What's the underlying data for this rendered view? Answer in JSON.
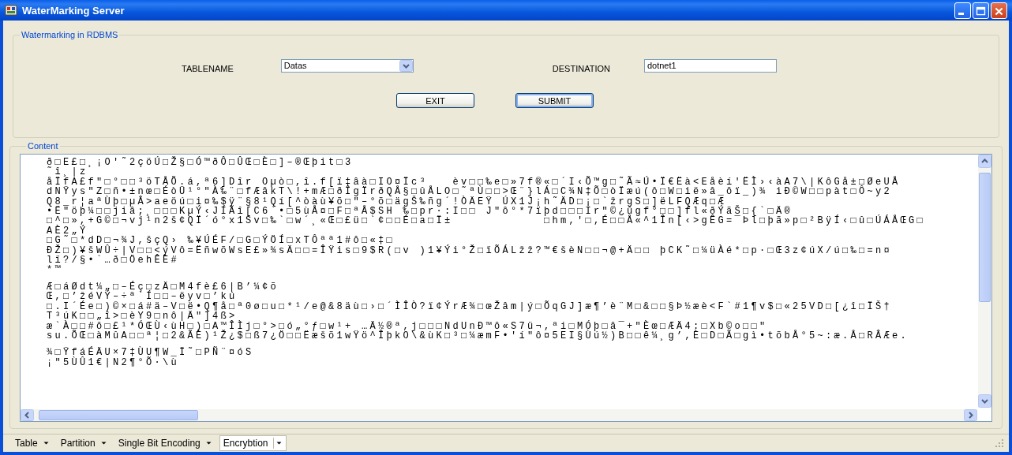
{
  "window": {
    "title": "WaterMarking Server"
  },
  "settings_group": {
    "title": "Watermarking in RDBMS",
    "tablename_label": "TABLENAME",
    "tablename_value": "Datas",
    "destination_label": "DESTINATION",
    "destination_value": "dotnet1",
    "buttons": [
      {
        "label": "EXIT",
        "focused": false
      },
      {
        "label": "SUBMIT",
        "focused": true
      }
    ]
  },
  "content_group": {
    "title": "Content",
    "paragraphs": [
      [
        "ð□E£□¸¡O′˜2çöÚ□Ž§□Ó™ðÔ□ÛŒ□È□]–®Œþit□3",
        "˜î¸|z",
        "åÏfA£f\"□°□□³öTÅÕ.á,ª6]Dîr Oµò□,î.f[ï‡âà□IO¤Ïc³   èv□□‰e□»7f®«□´I‹Õ™g□˜Ã≈Ú•Ï€Ëà<Eåèí'ËÌ›‹àA7\\|KôGå±□ØeUÅ",
        "dNŸys″Z□ñ•±nœ□ÉòÜ¹°″À‰¨□fÆâkT\\!+mÆ□ðÎgÏrðQÅ§□ûÅLO□˜ªÙ□□>Œ¨}lÁ□C¾N‡Õ□òÏæú(ô□W□ië»â_ôï_)¾ iÐ©W□□pàt□Ô~y2",
        "Q8_r¦aªÙþ□µÂ>aeöú□i¤‰$ÿ¨§8¹Qí[^òàù¥õ□″–°õ□ägŠ‰ñg´!ÒÄEŸ ÚX1J¡h˜ÄD□¡□`žrgS□]ëLFQÆq□Æ",
        "•Ë″öþ¼□□jiâ;¸□□□KµÝ‹JÍÃî[C6`•□5ùÅ¤□F□ªÅ$SH ‰□pr·:I□□ J″ô°*7ïþd□□□Ir″©¿ûgf°□□]fl«ðÝãŠ□{`□Ä®",
        "□^□»,+G©□¬vj¹n2š¢QÏ´ó°x1Sv□‰`□w´¸«Œ□£ü□`¢□□É□a□Ï±           □hm,'□,É□□Å«^1În[‹>gÊG=¯Þl□þã»p□²BÿÍ‹□û□ÚÁÅŒG□",
        "AÈ2„Ý",
        "□G˜□*dD□¬¾J,šçQ› ‰¥ÚÉF/□G□ÝÖÍ□xTÔªª1#ô□«‡□",
        "ÐŽ□)¥šWÛ÷|V□□<ýVô=ËñwõWsE£»¾sÄ□□=ÎŸis□9$R(□v )1¥Ýi°Ž□ïÕÁLžž?™€šèN□□¬@+Ä□□ þCK˜□¼üÀé*□p·□Œ3z¢úX/ú□‰□=n¤",
        "lï?/§•`…ð□ÖehÊÈ#",
        "*™"
      ],
      [
        "Æ□áØdt¼„□–Éç□zÄ□M4fè£6|B’¼¢õ",
        "Œ,□’žéVÝ–÷ª`Í□□–ëyv□’kú",
        "□.I´Ée□)©×□á#ä–V□ë•Q¶å□ª0ø□u□*¹/e@&8äù□›□´ÌÎÒ?ï¢ÝrÆ¾□œŽâm|ý□ÕqGJ]æ¶’è¨M□&□□§Þ½æè<F`#1¶v$□«25VD□[¿î□ÏŠ†",
        "T³úK□□„î>□èY9□nô|Ä″]4ß>",
        "æ`À□□#ô□£¹*ÓŒÙ‹ùH□)□A™ÎÌj□°>□ó„°ƒ□w¹+ …Ä½®ª,j□□□NdUnÐ™ô«S7ü¬,ªi□MÓþ□â¯+″Èœ□ÆÄ4:□Xb©o□□″",
        "su.ÕŒ□àMûA□□ª¦□2&ÃÈ)¹Ž¿$□ß7¿Ö□□Ëæšõ1wŸö^ÎþkO\\&ùK□³□¼æmF•'í″ô¤5EI§Ùú½)B□□ê¼¸g’,È□D□Ã□gì•tõbÅ°5~:æ.Å□RÂÆe."
      ],
      [
        "¾□ŸfáÉÄU×7‡ÙU¶W_Ï˜□PÑ¨¤óS",
        "¡″5ÙÛ1€|N2¶°Õ·\\ù"
      ]
    ]
  },
  "toolbar": [
    {
      "label": "Table",
      "selected": false
    },
    {
      "label": "Partition",
      "selected": false
    },
    {
      "label": "Single Bit Encoding",
      "selected": false
    },
    {
      "label": "Encrybtion",
      "selected": true
    }
  ]
}
